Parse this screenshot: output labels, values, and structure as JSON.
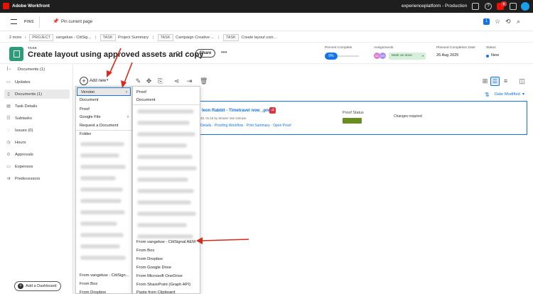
{
  "topbar": {
    "brand": "Adobe Workfront",
    "instance": "experienceplatform - Production",
    "notification_count": "9"
  },
  "pinsbar": {
    "pins_label": "PINS",
    "pin_current": "Pin current page",
    "count_badge": "1"
  },
  "breadcrumb": {
    "more": "2 more",
    "items": [
      {
        "tag": "PROJECT",
        "label": "vangeluw - CitiSig..."
      },
      {
        "tag": "TASK",
        "label": "Project Summary"
      },
      {
        "tag": "TASK",
        "label": "Campaign Creative ..."
      },
      {
        "tag": "TASK",
        "label": "Create layout usin..."
      }
    ]
  },
  "task": {
    "type_label": "TASK",
    "title": "Create layout using approved assets and copy",
    "share_label": "Share",
    "percent_label": "Percent Complete",
    "percent_value": "0%",
    "assign_label": "Assignments",
    "assignees": [
      "SG",
      "MG"
    ],
    "mark_done": "Mark as done",
    "planned_label": "Planned Completion Date",
    "planned_value": "26 Aug 2025",
    "status_label": "Status",
    "status_value": "New"
  },
  "sidebar": {
    "header": "Documents (1)",
    "items": [
      "Updates",
      "Documents (1)",
      "Task Details",
      "Subtasks",
      "Issues (0)",
      "Hours",
      "Approvals",
      "Expenses",
      "Predecessors"
    ],
    "add_dashboard": "Add a Dashboard"
  },
  "toolbar": {
    "add_new": "Add new",
    "sort_label": "Date Modified"
  },
  "document": {
    "name": "leon Rabbit - Timetravel now_.png",
    "meta": "25, 01:15 by Wouter Van Geluwe",
    "links": "Details · Proofing Workflow · Print Summary · Open Proof",
    "proof_status_label": "Proof Status",
    "proof_status_value": "Changes required"
  },
  "menu1": {
    "items": [
      "Version",
      "Document",
      "Proof",
      "Google File",
      "Request a Document",
      "Folder"
    ],
    "bottom_items": [
      "From vangeluw - CitiSign...",
      "From Box",
      "From Dropbox"
    ]
  },
  "menu2": {
    "items": [
      "Proof",
      "Document"
    ],
    "bottom_items": [
      "From vangeluw - CitiSignal AEM",
      "From Box",
      "From Dropbox",
      "From Google Drive",
      "From Microsoft OneDrive",
      "From SharePoint (Graph API)",
      "Paste from Clipboard"
    ]
  },
  "colors": {
    "accent": "#1473e6",
    "topbar_bg": "#1e1e1e",
    "annotation_red": "#d9291c",
    "done_green": "#d6efd9"
  }
}
